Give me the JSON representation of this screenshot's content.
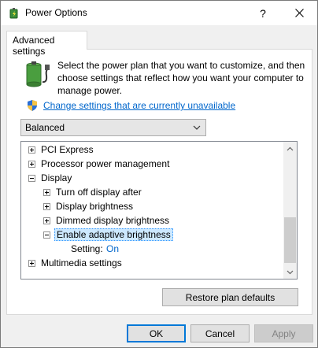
{
  "window": {
    "title": "Power Options",
    "help_glyph": "?",
    "close_icon": "close-icon"
  },
  "tabs": [
    {
      "label": "Advanced settings",
      "selected": true
    }
  ],
  "intro": {
    "text": "Select the power plan that you want to customize, and then choose settings that reflect how you want your computer to manage power.",
    "link_text": "Change settings that are currently unavailable"
  },
  "plan_select": {
    "value": "Balanced"
  },
  "tree": {
    "items": [
      {
        "label": "PCI Express",
        "expander": "plus"
      },
      {
        "label": "Processor power management",
        "expander": "plus"
      },
      {
        "label": "Display",
        "expander": "minus"
      },
      {
        "label": "Turn off display after",
        "expander": "plus"
      },
      {
        "label": "Display brightness",
        "expander": "plus"
      },
      {
        "label": "Dimmed display brightness",
        "expander": "plus"
      },
      {
        "label": "Enable adaptive brightness",
        "expander": "minus",
        "selected": true
      },
      {
        "label": "Multimedia settings",
        "expander": "plus"
      }
    ],
    "setting": {
      "label": "Setting:",
      "value": "On"
    }
  },
  "buttons": {
    "restore": "Restore plan defaults",
    "ok": "OK",
    "cancel": "Cancel",
    "apply": "Apply"
  },
  "colors": {
    "link": "#0066cc",
    "selection": "#cce8ff",
    "accent": "#0078d7"
  }
}
